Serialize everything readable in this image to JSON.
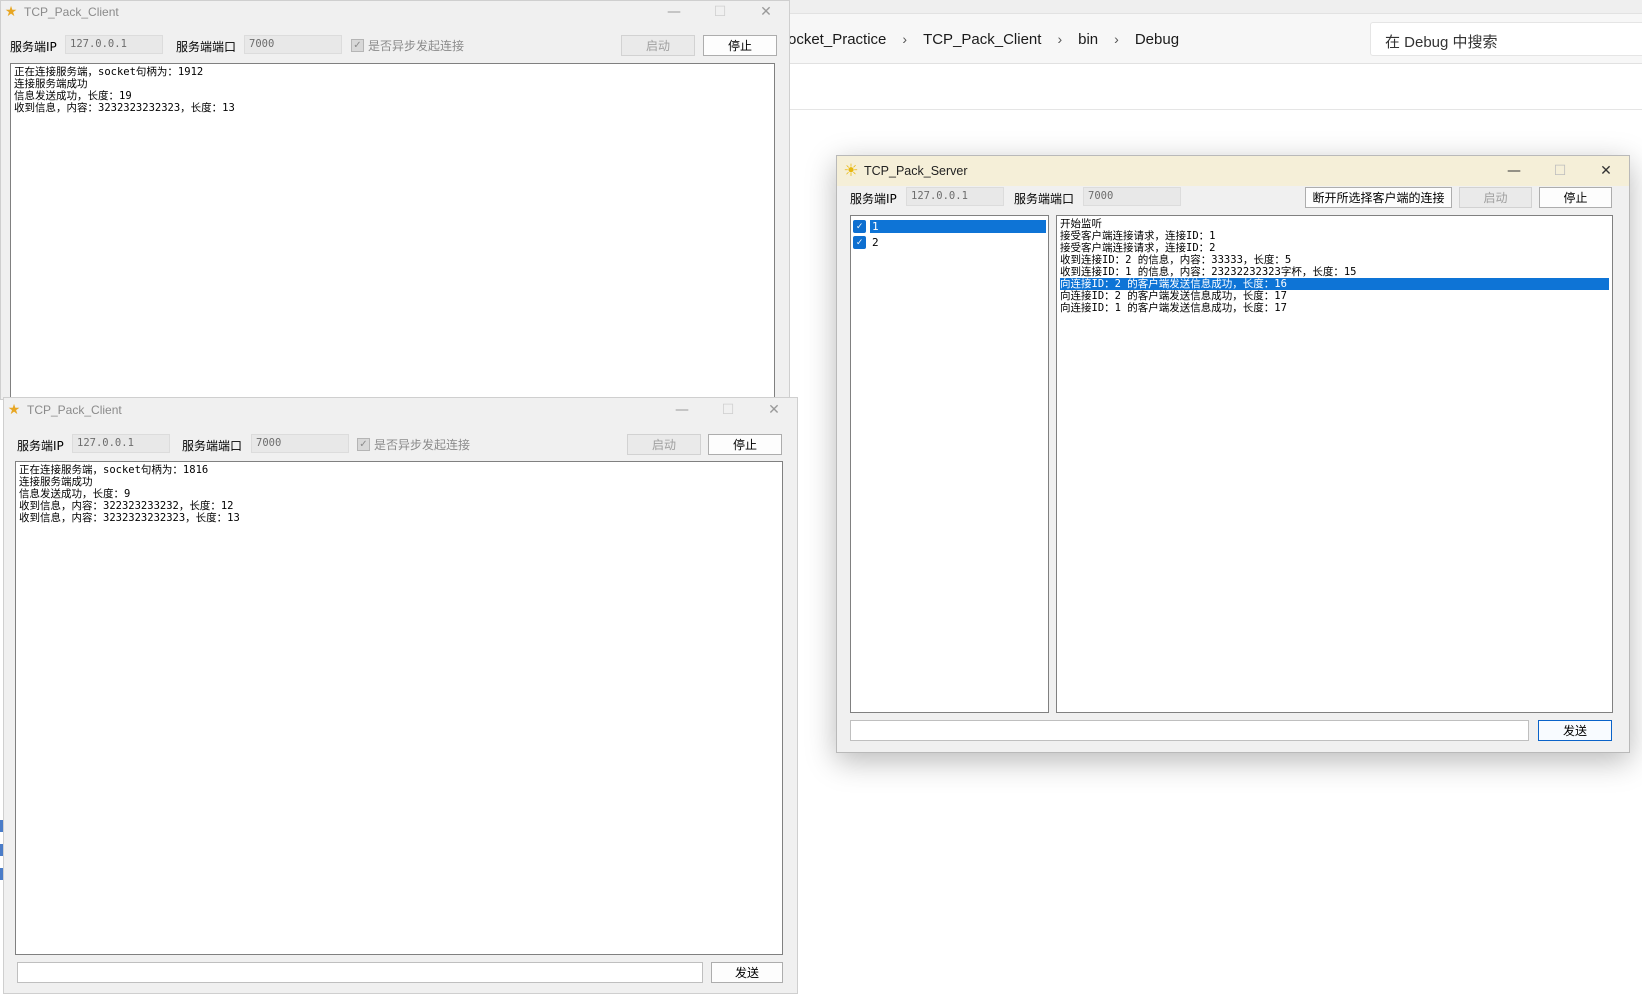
{
  "explorer": {
    "breadcrumbs": [
      "ocket_Practice",
      "TCP_Pack_Client",
      "bin",
      "Debug"
    ],
    "search_placeholder": "在 Debug 中搜索"
  },
  "client1": {
    "title": "TCP_Pack_Client",
    "ip_label": "服务端IP",
    "ip_value": "127.0.0.1",
    "port_label": "服务端端口",
    "port_value": "7000",
    "async_label": "是否异步发起连接",
    "async_checked": true,
    "start_label": "启动",
    "stop_label": "停止",
    "log": [
      "正在连接服务端，socket句柄为：1912",
      "连接服务端成功",
      "信息发送成功，长度：19",
      "收到信息，内容：3232323232323，长度：13"
    ]
  },
  "client2": {
    "title": "TCP_Pack_Client",
    "ip_label": "服务端IP",
    "ip_value": "127.0.0.1",
    "port_label": "服务端端口",
    "port_value": "7000",
    "async_label": "是否异步发起连接",
    "async_checked": true,
    "start_label": "启动",
    "stop_label": "停止",
    "send_label": "发送",
    "log": [
      "正在连接服务端，socket句柄为：1816",
      "连接服务端成功",
      "信息发送成功，长度：9",
      "收到信息，内容：322323233232，长度：12",
      "收到信息，内容：3232323232323，长度：13"
    ]
  },
  "server": {
    "title": "TCP_Pack_Server",
    "ip_label": "服务端IP",
    "ip_value": "127.0.0.1",
    "port_label": "服务端端口",
    "port_value": "7000",
    "disconnect_label": "断开所选择客户端的连接",
    "start_label": "启动",
    "stop_label": "停止",
    "send_label": "发送",
    "clients": [
      {
        "id": "1",
        "checked": true,
        "selected": true
      },
      {
        "id": "2",
        "checked": true,
        "selected": false
      }
    ],
    "log": [
      "开始监听",
      "接受客户端连接请求，连接ID：1",
      "接受客户端连接请求，连接ID：2",
      "收到连接ID：2 的信息，内容：33333，长度：5",
      "收到连接ID：1 的信息，内容：23232232323字杯，长度：15",
      "向连接ID：2 的客户端发送信息成功，长度：16",
      "向连接ID：2 的客户端发送信息成功，长度：17",
      "向连接ID：1 的客户端发送信息成功，长度：17"
    ],
    "log_selected_index": 5
  },
  "colors": {
    "selection": "#0e74d6",
    "server_titlebar": "#f5efd8",
    "window_bg": "#f0f0f0"
  }
}
